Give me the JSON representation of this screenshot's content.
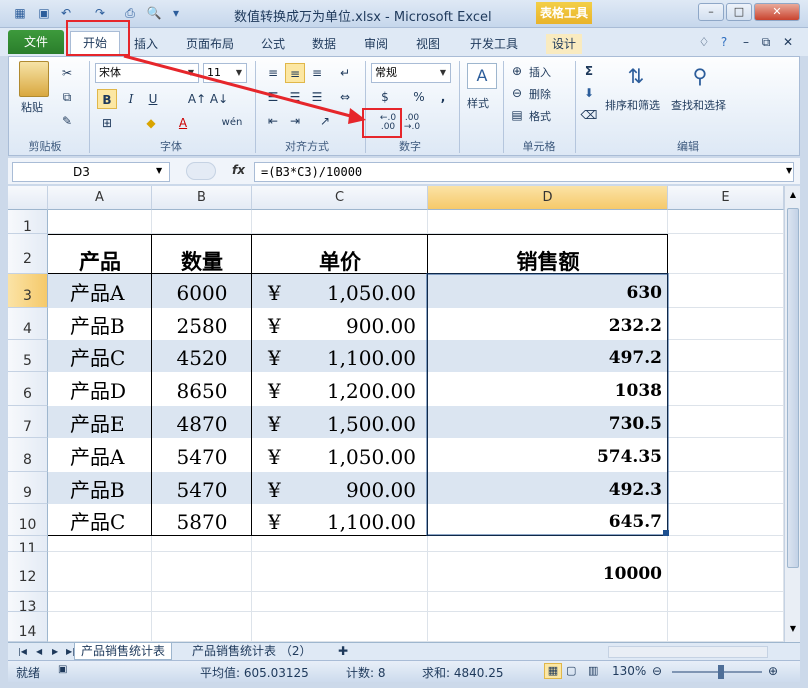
{
  "window": {
    "title": "数值转换成万为单位.xlsx  -  Microsoft Excel",
    "context_tab_title": "表格工具",
    "controls": [
      "–",
      "□",
      "✕"
    ]
  },
  "tabs": {
    "file": "文件",
    "home": "开始",
    "insert": "插入",
    "page_layout": "页面布局",
    "formulas": "公式",
    "data": "数据",
    "review": "审阅",
    "view": "视图",
    "developer": "开发工具",
    "design": "设计"
  },
  "ribbon": {
    "clipboard": {
      "paste": "粘贴",
      "label": "剪贴板"
    },
    "font": {
      "name": "宋体",
      "size": "11",
      "bold": "B",
      "italic": "I",
      "underline": "U",
      "label": "字体",
      "wen": "wén"
    },
    "alignment": {
      "label": "对齐方式"
    },
    "number": {
      "format": "常规",
      "percent": "%",
      "comma": ",",
      "inc_decimal": "←.0\n.00",
      "dec_decimal": ".00\n→.0",
      "label": "数字"
    },
    "styles": {
      "styles": "样式"
    },
    "cells": {
      "insert": "插入",
      "delete": "删除",
      "format": "格式",
      "label": "单元格"
    },
    "editing": {
      "sigma": "Σ",
      "sort_filter": "排序和筛选",
      "find_select": "查找和选择",
      "label": "编辑"
    }
  },
  "formula_bar": {
    "name_box": "D3",
    "fx": "fx",
    "formula": "=(B3*C3)/10000"
  },
  "grid": {
    "columns": [
      "A",
      "B",
      "C",
      "D",
      "E"
    ],
    "rows": [
      "1",
      "2",
      "3",
      "4",
      "5",
      "6",
      "7",
      "8",
      "9",
      "10",
      "11",
      "12",
      "13",
      "14"
    ],
    "headers": [
      "产品",
      "数量",
      "单价",
      "销售额"
    ],
    "data": [
      {
        "product": "产品A",
        "qty": "6000",
        "yen": "¥",
        "price": "1,050.00",
        "sales": "630"
      },
      {
        "product": "产品B",
        "qty": "2580",
        "yen": "¥",
        "price": "900.00",
        "sales": "232.2"
      },
      {
        "product": "产品C",
        "qty": "4520",
        "yen": "¥",
        "price": "1,100.00",
        "sales": "497.2"
      },
      {
        "product": "产品D",
        "qty": "8650",
        "yen": "¥",
        "price": "1,200.00",
        "sales": "1038"
      },
      {
        "product": "产品E",
        "qty": "4870",
        "yen": "¥",
        "price": "1,500.00",
        "sales": "730.5"
      },
      {
        "product": "产品A",
        "qty": "5470",
        "yen": "¥",
        "price": "1,050.00",
        "sales": "574.35"
      },
      {
        "product": "产品B",
        "qty": "5470",
        "yen": "¥",
        "price": "900.00",
        "sales": "492.3"
      },
      {
        "product": "产品C",
        "qty": "5870",
        "yen": "¥",
        "price": "1,100.00",
        "sales": "645.7"
      }
    ],
    "d12": "10000",
    "band_color": "#dbe5f1"
  },
  "sheets": {
    "tab1": "产品销售统计表",
    "tab2": "产品销售统计表 （2）"
  },
  "status": {
    "ready": "就绪",
    "average": "平均值: 605.03125",
    "count": "计数: 8",
    "sum": "求和: 4840.25",
    "zoom": "130%"
  },
  "colors": {
    "accent_red": "#e6262b",
    "file_tab": "#2a7e2b"
  }
}
